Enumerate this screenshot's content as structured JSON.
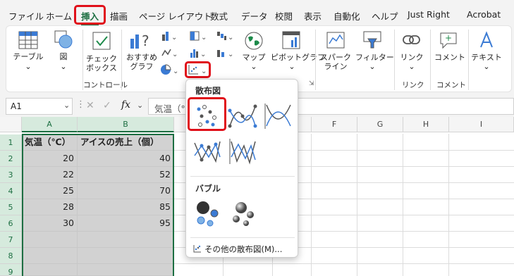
{
  "menu": {
    "tabs": [
      "ファイル",
      "ホーム",
      "挿入",
      "描画",
      "ページ レイアウト",
      "数式",
      "データ",
      "校閲",
      "表示",
      "自動化",
      "ヘルプ",
      "Just Right",
      "Acrobat"
    ],
    "active_tab": "挿入"
  },
  "ribbon": {
    "table": "テーブル",
    "illustration": "図",
    "checkbox_line1": "チェック",
    "checkbox_line2": "ボックス",
    "recommended_line1": "おすすめ",
    "recommended_line2": "グラフ",
    "map": "マップ",
    "pivot_chart": "ピボットグラフ",
    "sparkline_line1": "スパーク",
    "sparkline_line2": "ライン",
    "filter": "フィルター",
    "link": "リンク",
    "comment": "コメント",
    "text": "テキスト",
    "group_control": "コントロール",
    "group_link": "リンク",
    "group_comment": "コメント"
  },
  "formula_bar": {
    "name_box": "A1",
    "fx": "fx",
    "content": "気温（°"
  },
  "grid": {
    "columns": [
      "A",
      "B",
      "C",
      "D",
      "E",
      "F",
      "G",
      "H",
      "I"
    ],
    "rows": [
      "1",
      "2",
      "3",
      "4",
      "5",
      "6",
      "7",
      "8",
      "9"
    ],
    "headers": [
      "気温（℃）",
      "アイスの売上（個）"
    ],
    "data": [
      [
        "20",
        "40"
      ],
      [
        "22",
        "52"
      ],
      [
        "25",
        "70"
      ],
      [
        "28",
        "85"
      ],
      [
        "30",
        "95"
      ]
    ]
  },
  "dropdown": {
    "scatter_title": "散布図",
    "bubble_title": "バブル",
    "more_label": "その他の散布図(M)..."
  },
  "colors": {
    "accent": "#1d6f42",
    "highlight": "#e0101a"
  }
}
